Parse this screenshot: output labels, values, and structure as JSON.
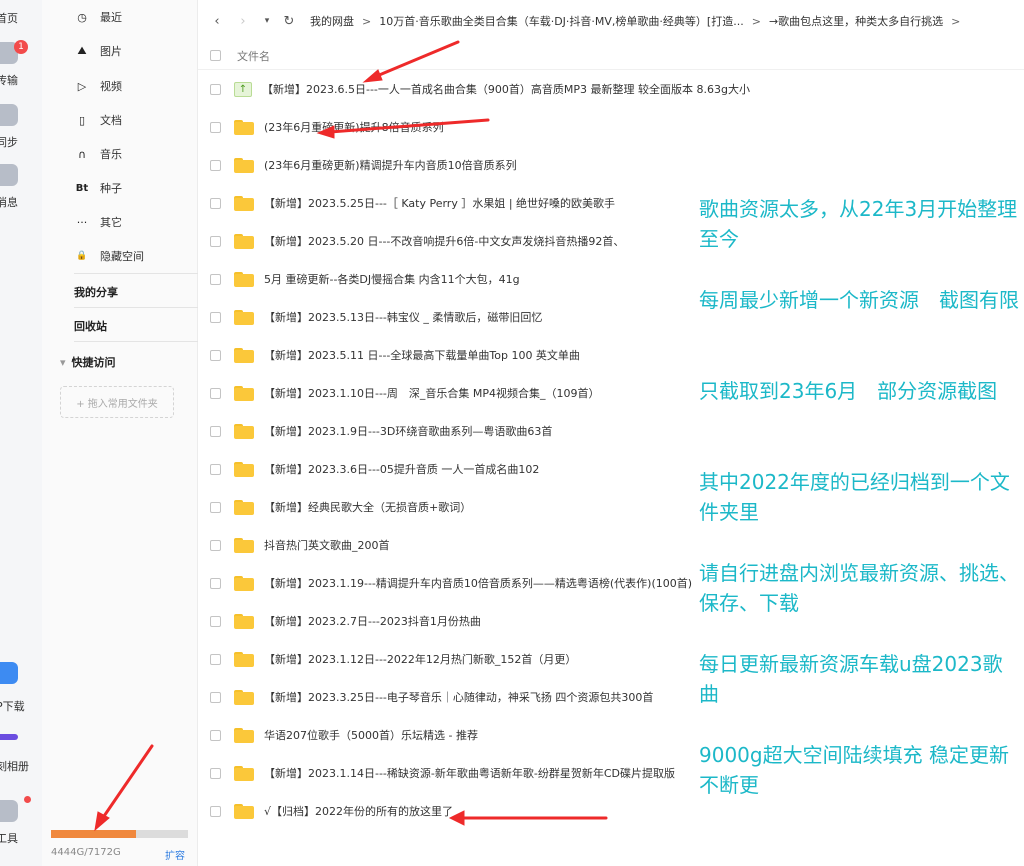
{
  "rail": {
    "items": [
      {
        "label": "首页"
      },
      {
        "label": "传输",
        "badge": "1"
      },
      {
        "label": "同步"
      },
      {
        "label": "消息"
      },
      {
        "label": "P下载"
      },
      {
        "label": "刻相册"
      },
      {
        "label": "工具"
      }
    ]
  },
  "sidebar": {
    "items": [
      {
        "label": "最近",
        "icon": "clock-icon",
        "glyph": "◷"
      },
      {
        "label": "图片",
        "icon": "image-icon",
        "glyph": "⛰"
      },
      {
        "label": "视频",
        "icon": "play-icon",
        "glyph": "▷"
      },
      {
        "label": "文档",
        "icon": "document-icon",
        "glyph": "▯"
      },
      {
        "label": "音乐",
        "icon": "headphones-icon",
        "glyph": "∩"
      },
      {
        "label": "种子",
        "icon": "bt-icon",
        "glyph": "Bt"
      },
      {
        "label": "其它",
        "icon": "more-icon",
        "glyph": "···"
      },
      {
        "label": "隐藏空间",
        "icon": "lock-icon",
        "glyph": "🔒"
      }
    ],
    "my_share": "我的分享",
    "recycle": "回收站",
    "quick_access": "快捷访问",
    "quick_access_arrow": "▾",
    "add_common": "+ 拖入常用文件夹",
    "storage": {
      "used_total": "4444G/7172G",
      "used_fraction": 0.6196,
      "expand": "扩容",
      "fill_color": "#f0883d"
    }
  },
  "toolbar": {
    "back": "‹",
    "forward": "›",
    "dropdown": "▾",
    "refresh": "↻",
    "breadcrumb": [
      "我的网盘",
      "10万首·音乐歌曲全类目合集（车载·DJ·抖音·MV,榜单歌曲·经典等）[打造...",
      "→歌曲包点这里，种类太多自行挑选"
    ],
    "crumb_sep": ">"
  },
  "list": {
    "header": "文件名",
    "files": [
      {
        "name": "【新增】2023.6.5日---一人一首成名曲合集（900首）高音质MP3 最新整理 较全面版本 8.63g大小",
        "type": "file"
      },
      {
        "name": "(23年6月重磅更新)提升8倍音质系列",
        "type": "folder"
      },
      {
        "name": "(23年6月重磅更新)精调提升车内音质10倍音质系列",
        "type": "folder"
      },
      {
        "name": "【新增】2023.5.25日---［ Katy Perry ］水果姐 | 绝世好嗓的欧美歌手",
        "type": "folder"
      },
      {
        "name": "【新增】2023.5.20 日---不改音响提升6倍-中文女声发烧抖音热播92首、",
        "type": "folder"
      },
      {
        "name": "5月 重磅更新--各类DJ慢摇合集 内含11个大包，41g",
        "type": "folder"
      },
      {
        "name": "【新增】2023.5.13日---韩宝仪 _ 柔情歌后，磁带旧回忆",
        "type": "folder"
      },
      {
        "name": "【新增】2023.5.11 日---全球最高下载量单曲Top 100 英文单曲",
        "type": "folder"
      },
      {
        "name": "【新增】2023.1.10日---周　深_音乐合集 MP4视频合集_（109首）",
        "type": "folder"
      },
      {
        "name": "【新增】2023.1.9日---3D环绕音歌曲系列—粤语歌曲63首",
        "type": "folder"
      },
      {
        "name": "【新增】2023.3.6日---05提升音质 一人一首成名曲102",
        "type": "folder"
      },
      {
        "name": "【新增】经典民歌大全（无损音质+歌词）",
        "type": "folder"
      },
      {
        "name": "抖音热门英文歌曲_200首",
        "type": "folder"
      },
      {
        "name": "【新增】2023.1.19---精调提升车内音质10倍音质系列——精选粤语榜(代表作)(100首)",
        "type": "folder"
      },
      {
        "name": "【新增】2023.2.7日---2023抖音1月份热曲",
        "type": "folder"
      },
      {
        "name": "【新增】2023.1.12日---2022年12月热门新歌_152首（月更）",
        "type": "folder"
      },
      {
        "name": "【新增】2023.3.25日---电子琴音乐｜心随律动，神采飞扬 四个资源包共300首",
        "type": "folder"
      },
      {
        "name": "华语207位歌手（5000首）乐坛精选 - 推荐",
        "type": "folder"
      },
      {
        "name": "【新增】2023.1.14日---稀缺资源-新年歌曲粤语新年歌-纷群星贺新年CD碟片提取版",
        "type": "folder"
      },
      {
        "name": "√【归档】2022年份的所有的放这里了",
        "type": "folder"
      }
    ]
  },
  "annotations": [
    "歌曲资源太多，从22年3月开始整理至今",
    "每周最少新增一个新资源　截图有限",
    "只截取到23年6月　部分资源截图",
    "其中2022年度的已经归档到一个文件夹里",
    "请自行进盘内浏览最新资源、挑选、保存、下载",
    "每日更新最新资源车载u盘2023歌曲",
    "9000g超大空间陆续填充 稳定更新不断更"
  ],
  "colors": {
    "annotation": "#1cb8c8",
    "arrow": "#ee2a2a",
    "folder": "#fbc83a"
  }
}
